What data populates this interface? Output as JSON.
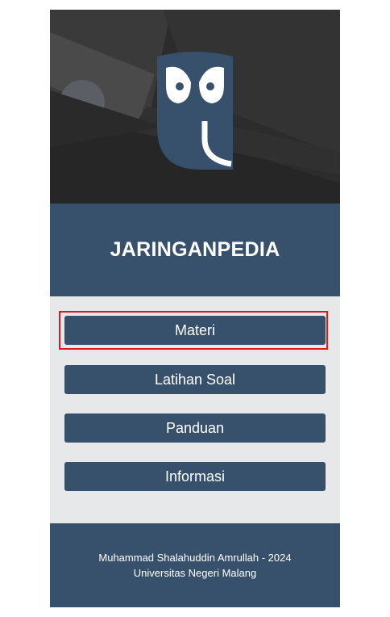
{
  "app": {
    "title": "JARINGANPEDIA",
    "logo_icon": "owl-logo-icon"
  },
  "menu": {
    "items": [
      {
        "label": "Materi",
        "highlighted": true
      },
      {
        "label": "Latihan Soal",
        "highlighted": false
      },
      {
        "label": "Panduan",
        "highlighted": false
      },
      {
        "label": "Informasi",
        "highlighted": false
      }
    ]
  },
  "footer": {
    "line1": "Muhammad Shalahuddin Amrullah - 2024",
    "line2": "Universitas Negeri Malang"
  },
  "colors": {
    "primary": "#37506b",
    "background": "#e7e8ea",
    "hero_dark": "#2b2b2b",
    "highlight": "#e01818"
  }
}
